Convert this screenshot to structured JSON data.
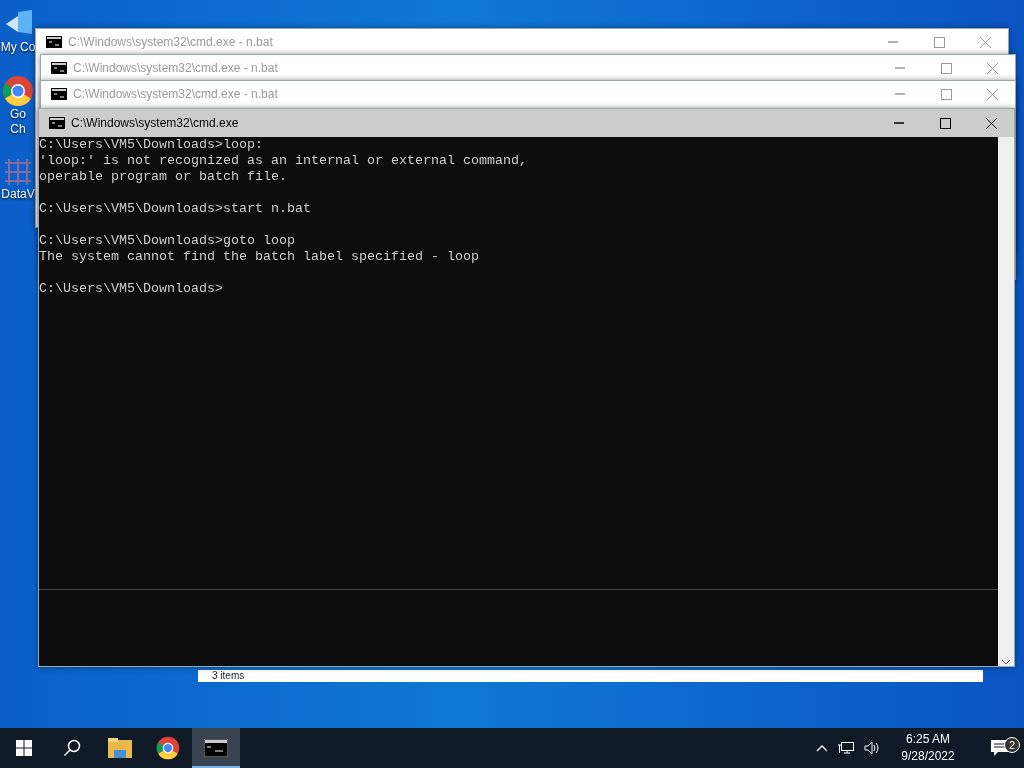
{
  "desktop_icons": [
    {
      "kind": "pc",
      "lines": [
        "My Co"
      ]
    },
    {
      "kind": "chrome",
      "lines": [
        "Go",
        "Ch"
      ]
    },
    {
      "kind": "data",
      "lines": [
        "DataV"
      ]
    }
  ],
  "explorer": {
    "status": "3 items"
  },
  "windows": [
    {
      "title": "C:\\Windows\\system32\\cmd.exe - n.bat",
      "active": false
    },
    {
      "title": "C:\\Windows\\system32\\cmd.exe - n.bat",
      "active": false
    },
    {
      "title": "C:\\Windows\\system32\\cmd.exe - n.bat",
      "active": false
    },
    {
      "title": "C:\\Windows\\system32\\cmd.exe",
      "active": true
    }
  ],
  "console": {
    "blocks": [
      {
        "lines": [
          "C:\\Users\\VM5\\Downloads>loop:",
          "'loop:' is not recognized as an internal or external command,",
          "operable program or batch file."
        ]
      },
      {
        "lines": [
          "C:\\Users\\VM5\\Downloads>start n.bat"
        ]
      },
      {
        "lines": [
          "C:\\Users\\VM5\\Downloads>goto loop",
          "The system cannot find the batch label specified - loop"
        ]
      },
      {
        "lines": [
          "C:\\Users\\VM5\\Downloads>"
        ]
      }
    ]
  },
  "taskbar": {
    "items": [
      {
        "kind": "start",
        "selected": false
      },
      {
        "kind": "search",
        "selected": false
      },
      {
        "kind": "explorer",
        "selected": false
      },
      {
        "kind": "chrome",
        "selected": false
      },
      {
        "kind": "cmd",
        "selected": true
      }
    ],
    "time": "6:25 AM",
    "date": "9/28/2022",
    "notifications": "2"
  }
}
